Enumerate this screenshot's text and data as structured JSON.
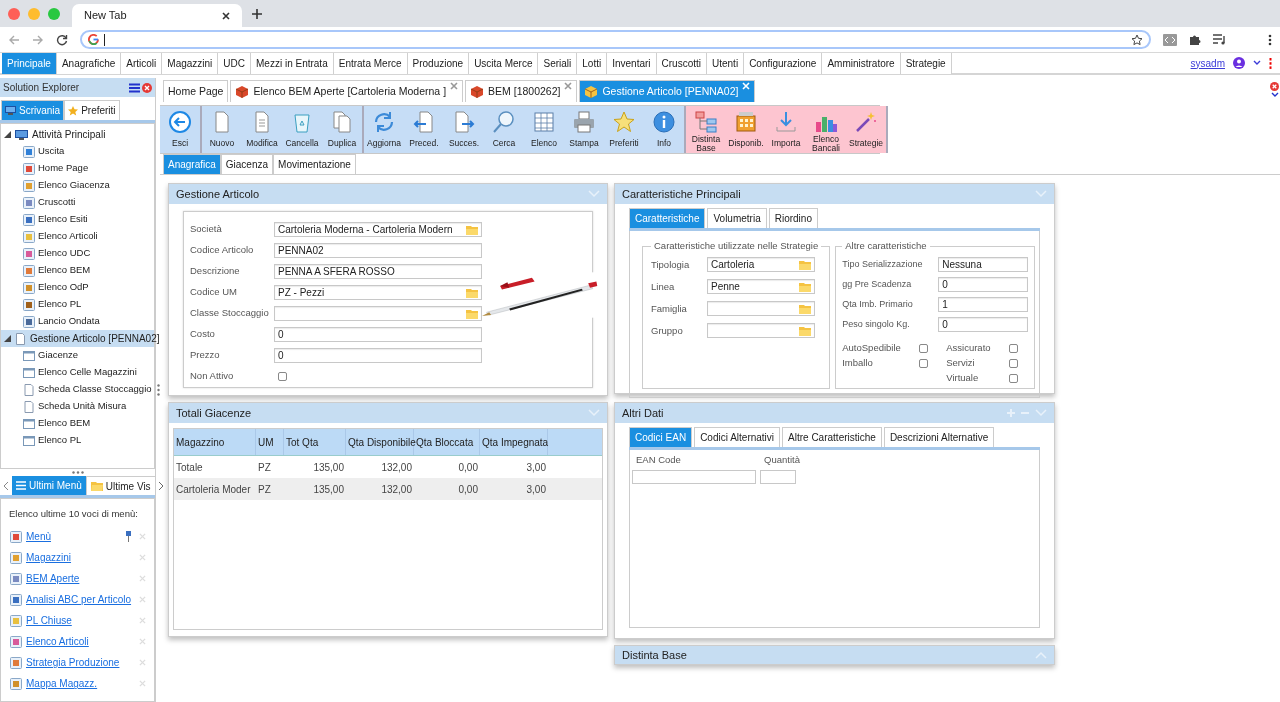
{
  "browser": {
    "tab_title": "New Tab"
  },
  "menu": [
    {
      "label": "Principale",
      "selected": true
    },
    {
      "label": "Anagrafiche",
      "selected": false
    },
    {
      "label": "Articoli",
      "selected": false
    },
    {
      "label": "Magazzini",
      "selected": false
    },
    {
      "label": "UDC",
      "selected": false
    },
    {
      "label": "Mezzi in Entrata",
      "selected": false
    },
    {
      "label": "Entrata Merce",
      "selected": false
    },
    {
      "label": "Produzione",
      "selected": false
    },
    {
      "label": "Uscita Merce",
      "selected": false
    },
    {
      "label": "Seriali",
      "selected": false
    },
    {
      "label": "Lotti",
      "selected": false
    },
    {
      "label": "Inventari",
      "selected": false
    },
    {
      "label": "Cruscotti",
      "selected": false
    },
    {
      "label": "Utenti",
      "selected": false
    },
    {
      "label": "Configurazione",
      "selected": false
    },
    {
      "label": "Amministratore",
      "selected": false
    },
    {
      "label": "Strategie",
      "selected": false
    }
  ],
  "user": "sysadm",
  "explorer": {
    "title": "Solution Explorer",
    "tabs": [
      {
        "label": "Scrivania",
        "selected": true
      },
      {
        "label": "Preferiti",
        "selected": false
      }
    ],
    "tree": [
      {
        "label": "Attività Principali",
        "expanded": true,
        "selected": false,
        "children": [
          {
            "label": "Uscita"
          },
          {
            "label": "Home Page"
          },
          {
            "label": "Elenco Giacenza"
          },
          {
            "label": "Cruscotti"
          },
          {
            "label": "Elenco Esiti"
          },
          {
            "label": "Elenco Articoli"
          },
          {
            "label": "Elenco UDC"
          },
          {
            "label": "Elenco BEM"
          },
          {
            "label": "Elenco OdP"
          },
          {
            "label": "Elenco PL"
          },
          {
            "label": "Lancio Ondata"
          }
        ]
      },
      {
        "label": "Gestione Articolo [PENNA02]",
        "expanded": true,
        "selected": true,
        "children": [
          {
            "label": "Giacenze"
          },
          {
            "label": "Elenco Celle Magazzini"
          },
          {
            "label": "Scheda Classe Stoccaggio"
          },
          {
            "label": "Scheda Unità Misura"
          },
          {
            "label": "Elenco BEM"
          },
          {
            "label": "Elenco PL"
          }
        ]
      }
    ]
  },
  "recent": {
    "tabs": [
      {
        "label": "Ultimi Menù",
        "selected": true
      },
      {
        "label": "Ultime Vis",
        "selected": false
      }
    ],
    "heading": "Elenco ultime 10 voci di menù:",
    "items": [
      {
        "label": "Menù",
        "pinned": true
      },
      {
        "label": "Magazzini",
        "pinned": false
      },
      {
        "label": "BEM Aperte",
        "pinned": false
      },
      {
        "label": "Analisi ABC per Articolo",
        "pinned": false
      },
      {
        "label": "PL Chiuse",
        "pinned": false
      },
      {
        "label": "Elenco Articoli",
        "pinned": false
      },
      {
        "label": "Strategia Produzione",
        "pinned": false
      },
      {
        "label": "Mappa Magazz.",
        "pinned": false
      }
    ]
  },
  "doc_tabs": [
    {
      "label": "Home Page",
      "selected": false,
      "closable": false
    },
    {
      "label": "Elenco BEM Aperte [Cartoleria Moderna ]",
      "selected": false,
      "closable": true
    },
    {
      "label": "BEM [1800262]",
      "selected": false,
      "closable": true
    },
    {
      "label": "Gestione Articolo [PENNA02]",
      "selected": true,
      "closable": true
    }
  ],
  "toolbar": [
    {
      "kind": "standard",
      "buttons": [
        "Esci"
      ]
    },
    {
      "kind": "standard",
      "buttons": [
        "Nuovo",
        "Modifica",
        "Cancella",
        "Duplica"
      ]
    },
    {
      "kind": "standard",
      "buttons": [
        "Aggiorna",
        "Preced.",
        "Succes.",
        "Cerca",
        "Elenco",
        "Stampa",
        "Preferiti",
        "Info"
      ]
    },
    {
      "kind": "special",
      "buttons": [
        "Distinta Base",
        "Disponib.",
        "Importa",
        "Elenco Bancali",
        "Strategie"
      ]
    }
  ],
  "sub_tabs": [
    {
      "label": "Anagrafica",
      "selected": true
    },
    {
      "label": "Giacenza",
      "selected": false
    },
    {
      "label": "Movimentazione",
      "selected": false
    }
  ],
  "gestione_articolo": {
    "title": "Gestione Articolo",
    "fields": [
      {
        "label": "Società",
        "kind": "lookup",
        "value": "Cartoleria Moderna - Cartoleria Modern"
      },
      {
        "label": "Codice Articolo",
        "kind": "text",
        "value": "PENNA02"
      },
      {
        "label": "Descrizione",
        "kind": "text",
        "value": "PENNA A SFERA ROSSO"
      },
      {
        "label": "Codice UM",
        "kind": "lookup",
        "value": "PZ - Pezzi"
      },
      {
        "label": "Classe Stoccaggio",
        "kind": "lookup"
      },
      {
        "label": "Costo",
        "kind": "text",
        "value": "0"
      },
      {
        "label": "Prezzo",
        "kind": "text",
        "value": "0"
      },
      {
        "label": "Non Attivo",
        "kind": "checkbox",
        "checked": false
      }
    ]
  },
  "totali_giacenze": {
    "title": "Totali Giacenze",
    "columns": [
      "Magazzino",
      "UM",
      "Tot Qta",
      "Qta Disponibile",
      "Qta Bloccata",
      "Qta Impegnata"
    ],
    "rows": [
      [
        "Totale",
        "PZ",
        "135,00",
        "132,00",
        "0,00",
        "3,00"
      ],
      [
        "Cartoleria Moder",
        "PZ",
        "135,00",
        "132,00",
        "0,00",
        "3,00"
      ]
    ]
  },
  "caratteristiche": {
    "title": "Caratteristiche Principali",
    "tabs": [
      {
        "label": "Caratteristiche",
        "selected": true
      },
      {
        "label": "Volumetria",
        "selected": false
      },
      {
        "label": "Riordino",
        "selected": false
      }
    ],
    "group_1": {
      "legend": "Caratteristiche utilizzate nelle Strategie",
      "fields": [
        {
          "label": "Tipologia",
          "kind": "lookup",
          "value": "Cartoleria"
        },
        {
          "label": "Linea",
          "kind": "lookup",
          "value": "Penne"
        },
        {
          "label": "Famiglia",
          "kind": "lookup"
        },
        {
          "label": "Gruppo",
          "kind": "lookup"
        }
      ]
    },
    "group_2": {
      "legend": "Altre caratteristiche",
      "fields": [
        {
          "label": "Tipo Serializzazione",
          "kind": "text",
          "value": "Nessuna"
        },
        {
          "label": "gg Pre Scadenza",
          "kind": "text",
          "value": "0"
        },
        {
          "label": "Qta Imb. Primario",
          "kind": "text",
          "value": "1"
        },
        {
          "label": "Peso singolo Kg.",
          "kind": "text",
          "value": "0"
        }
      ],
      "checkbox_columns": [
        [
          {
            "label": "AutoSpedibile",
            "checked": false
          },
          {
            "label": "Imballo",
            "checked": false
          }
        ],
        [
          {
            "label": "Assicurato",
            "checked": false
          },
          {
            "label": "Servizi",
            "checked": false
          },
          {
            "label": "Virtuale",
            "checked": false
          }
        ]
      ]
    }
  },
  "altri_dati": {
    "title": "Altri Dati",
    "tabs": [
      {
        "label": "Codici EAN",
        "selected": true
      },
      {
        "label": "Codici Alternativi",
        "selected": false
      },
      {
        "label": "Altre Caratteristiche",
        "selected": false
      },
      {
        "label": "Descrizioni Alternative",
        "selected": false
      }
    ],
    "columns": [
      "EAN Code",
      "Quantità"
    ]
  },
  "distinta_base": {
    "title": "Distinta Base"
  }
}
